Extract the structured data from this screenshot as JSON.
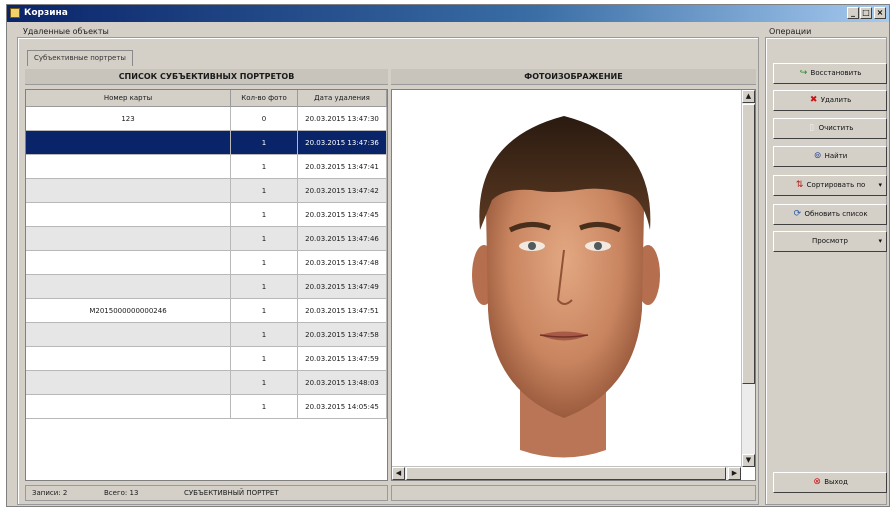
{
  "window": {
    "title": "Корзина"
  },
  "groups": {
    "deleted_objects": "Удаленные объекты",
    "operations": "Операции"
  },
  "tab": {
    "label": "Субъективные портреты"
  },
  "panels": {
    "list_title": "СПИСОК СУБЪЕКТИВНЫХ ПОРТРЕТОВ",
    "photo_title": "ФОТОИЗОБРАЖЕНИЕ"
  },
  "table": {
    "columns": [
      "Номер карты",
      "Кол-во фото",
      "Дата удаления"
    ],
    "rows": [
      {
        "card": "123",
        "count": "0",
        "date": "20.03.2015 13:47:30"
      },
      {
        "card": "",
        "count": "1",
        "date": "20.03.2015 13:47:36"
      },
      {
        "card": "",
        "count": "1",
        "date": "20.03.2015 13:47:41"
      },
      {
        "card": "",
        "count": "1",
        "date": "20.03.2015 13:47:42"
      },
      {
        "card": "",
        "count": "1",
        "date": "20.03.2015 13:47:45"
      },
      {
        "card": "",
        "count": "1",
        "date": "20.03.2015 13:47:46"
      },
      {
        "card": "",
        "count": "1",
        "date": "20.03.2015 13:47:48"
      },
      {
        "card": "",
        "count": "1",
        "date": "20.03.2015 13:47:49"
      },
      {
        "card": "М2015000000000246",
        "count": "1",
        "date": "20.03.2015 13:47:51"
      },
      {
        "card": "",
        "count": "1",
        "date": "20.03.2015 13:47:58"
      },
      {
        "card": "",
        "count": "1",
        "date": "20.03.2015 13:47:59"
      },
      {
        "card": "",
        "count": "1",
        "date": "20.03.2015 13:48:03"
      },
      {
        "card": "",
        "count": "1",
        "date": "20.03.2015 14:05:45"
      }
    ]
  },
  "status": {
    "records": "Записи: 2",
    "total": "Всего: 13",
    "type": "СУБЪЕКТИВНЫЙ ПОРТРЕТ"
  },
  "buttons": {
    "restore": "Восстановить",
    "delete": "Удалить",
    "clear": "Очистить",
    "find": "Найти",
    "sort": "Сортировать по",
    "refresh": "Обновить список",
    "view": "Просмотр",
    "exit": "Выход"
  },
  "icons": {
    "restore": "green-arrow-icon",
    "delete": "red-x-icon",
    "clear": "eraser-icon",
    "find": "binoculars-icon",
    "sort": "sort-icon",
    "refresh": "refresh-icon",
    "exit": "exit-icon"
  }
}
